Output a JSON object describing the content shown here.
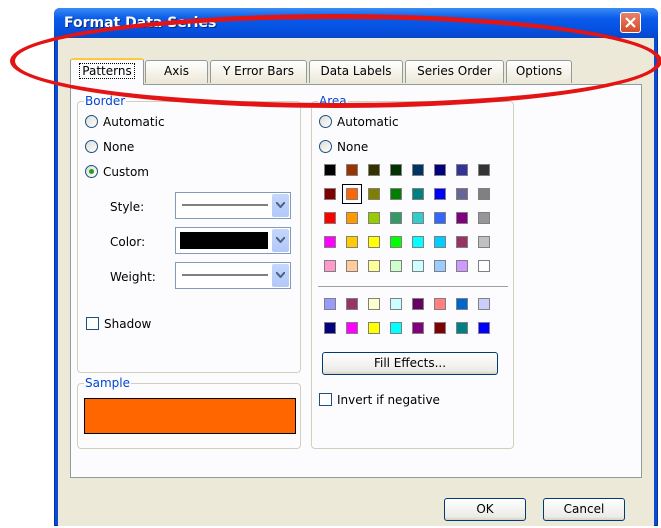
{
  "window": {
    "title": "Format Data Series"
  },
  "tabs": [
    {
      "label": "Patterns",
      "active": true
    },
    {
      "label": "Axis"
    },
    {
      "label": "Y Error Bars"
    },
    {
      "label": "Data Labels"
    },
    {
      "label": "Series Order"
    },
    {
      "label": "Options"
    }
  ],
  "border": {
    "title": "Border",
    "options": [
      "Automatic",
      "None",
      "Custom"
    ],
    "selected": "Custom",
    "style_label": "Style:",
    "color_label": "Color:",
    "weight_label": "Weight:",
    "color_value": "#000000",
    "shadow_label": "Shadow"
  },
  "sample": {
    "title": "Sample",
    "color": "#ff6600"
  },
  "area": {
    "title": "Area",
    "options": [
      "Automatic",
      "None"
    ],
    "palette_main": [
      [
        "#000000",
        "#993300",
        "#333300",
        "#003300",
        "#003366",
        "#000080",
        "#333399",
        "#333333"
      ],
      [
        "#800000",
        "#ff6600",
        "#808000",
        "#008000",
        "#008080",
        "#0000ff",
        "#666699",
        "#808080"
      ],
      [
        "#ff0000",
        "#ff9900",
        "#99cc00",
        "#339966",
        "#33cccc",
        "#3366ff",
        "#800080",
        "#969696"
      ],
      [
        "#ff00ff",
        "#ffcc00",
        "#ffff00",
        "#00ff00",
        "#00ffff",
        "#00ccff",
        "#993366",
        "#c0c0c0"
      ],
      [
        "#ff99cc",
        "#ffcc99",
        "#ffff99",
        "#ccffcc",
        "#ccffff",
        "#99ccff",
        "#cc99ff",
        "#ffffff"
      ]
    ],
    "palette_chart": [
      [
        "#9999ff",
        "#993366",
        "#ffffcc",
        "#ccffff",
        "#660066",
        "#ff8080",
        "#0066cc",
        "#ccccff"
      ],
      [
        "#000080",
        "#ff00ff",
        "#ffff00",
        "#00ffff",
        "#800080",
        "#800000",
        "#008080",
        "#0000ff"
      ]
    ],
    "fill_effects_label": "Fill Effects...",
    "invert_label": "Invert if negative"
  },
  "buttons": {
    "ok": "OK",
    "cancel": "Cancel"
  },
  "colors": {
    "annotation": "#e41414",
    "tab_highlight": "#ffc83c",
    "group_title": "#0046d5"
  }
}
